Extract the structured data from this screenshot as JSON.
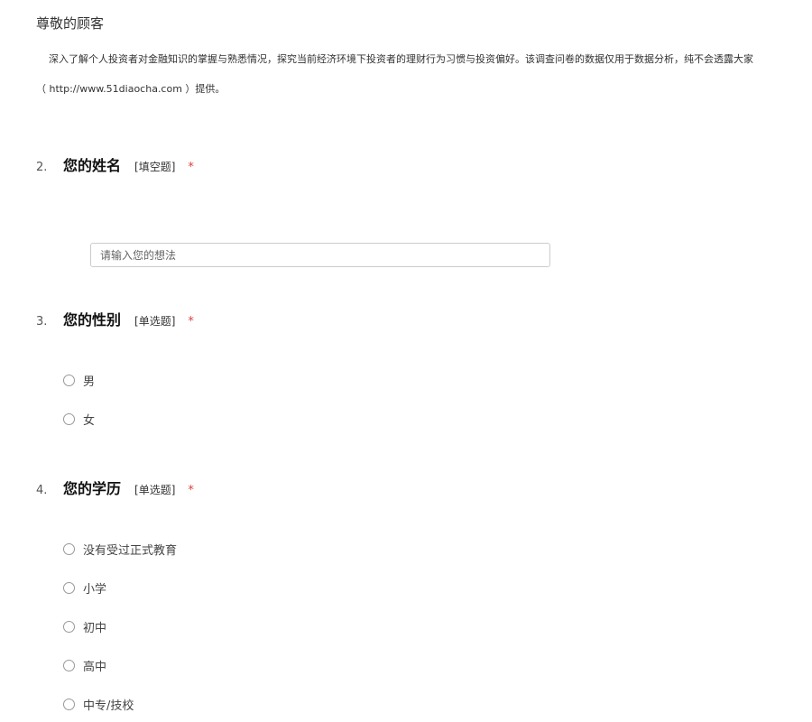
{
  "header": {
    "greeting": "尊敬的顾客",
    "intro_line1": "深入了解个人投资者对金融知识的掌握与熟悉情况，探究当前经济环境下投资者的理财行为习惯与投资偏好。该调查问卷的数据仅用于数据分析，纯不会透露大家",
    "intro_line2": "（ http://www.51diaocha.com ）提供。"
  },
  "questions": [
    {
      "number": "2.",
      "title": "您的姓名",
      "type": "[填空题]",
      "required": "*",
      "placeholder": "请输入您的想法"
    },
    {
      "number": "3.",
      "title": "您的性别",
      "type": "[单选题]",
      "required": "*",
      "options": [
        "男",
        "女"
      ]
    },
    {
      "number": "4.",
      "title": "您的学历",
      "type": "[单选题]",
      "required": "*",
      "options": [
        "没有受过正式教育",
        "小学",
        "初中",
        "高中",
        "中专/技校"
      ]
    }
  ]
}
